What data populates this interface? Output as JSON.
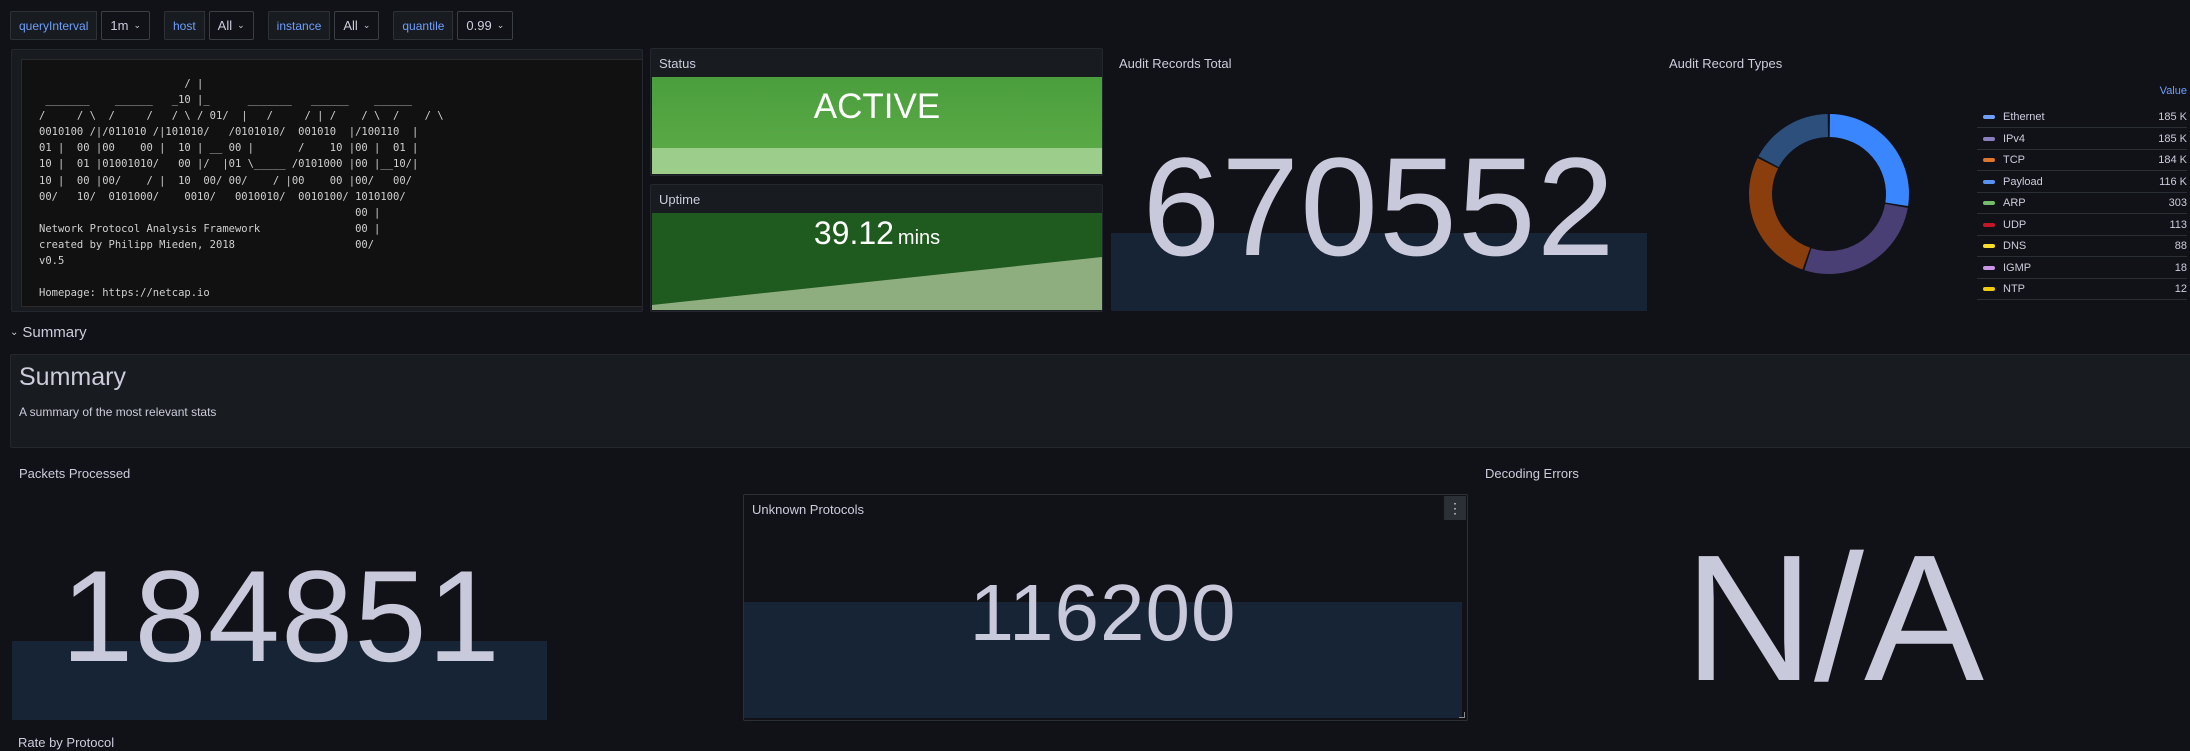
{
  "variables": [
    {
      "label": "queryInterval",
      "value": "1m"
    },
    {
      "label": "host",
      "value": "All"
    },
    {
      "label": "instance",
      "value": "All"
    },
    {
      "label": "quantile",
      "value": "0.99"
    }
  ],
  "ascii": {
    "art": "                       / |\n _______    ______   _10 |_      _______   ______    ______\n/     / \\  /     /   / \\ / 01/  |   /     / | /    / \\  /    / \\\n0010100 /|/011010 /|101010/   /0101010/  001010  |/100110  |\n01 |  00 |00    00 |  10 | __ 00 |       /    10 |00 |  01 |\n10 |  01 |01001010/   00 |/  |01 \\_____ /0101000 |00 |__10/|\n10 |  00 |00/    / |  10  00/ 00/    / |00    00 |00/   00/\n00/   10/  0101000/    0010/   0010010/  0010100/ 1010100/\n                                                  00 |\nNetwork Protocol Analysis Framework               00 |\ncreated by Philipp Mieden, 2018                   00/\nv0.5\n\nHomepage: https://netcap.io"
  },
  "status": {
    "title": "Status",
    "value": "ACTIVE",
    "color": "#56a64b"
  },
  "uptime": {
    "title": "Uptime",
    "value": "39.12",
    "unit": "mins",
    "color": "#1f5a1e"
  },
  "audit_total": {
    "title": "Audit Records Total",
    "value": "670552"
  },
  "audit_types": {
    "title": "Audit Record Types",
    "legend_header": "Value",
    "items": [
      {
        "name": "Ethernet",
        "value": "185 K",
        "color": "#6e9fff"
      },
      {
        "name": "IPv4",
        "value": "185 K",
        "color": "#8a7fbf"
      },
      {
        "name": "TCP",
        "value": "184 K",
        "color": "#e0752d"
      },
      {
        "name": "Payload",
        "value": "116 K",
        "color": "#5794f2"
      },
      {
        "name": "ARP",
        "value": "303",
        "color": "#73bf69"
      },
      {
        "name": "UDP",
        "value": "113",
        "color": "#c4162a"
      },
      {
        "name": "DNS",
        "value": "88",
        "color": "#fade2a"
      },
      {
        "name": "IGMP",
        "value": "18",
        "color": "#ca95e5"
      },
      {
        "name": "NTP",
        "value": "12",
        "color": "#f2cc0c"
      }
    ],
    "slice_values": [
      185,
      185,
      184,
      116,
      0.303,
      0.113,
      0.088,
      0.018,
      0.012
    ],
    "slice_colors": [
      "#3a86ff",
      "#4a3f75",
      "#8a3e0e",
      "#2c4f7c",
      "#73bf69",
      "#c4162a",
      "#fade2a",
      "#ca95e5",
      "#f2cc0c"
    ]
  },
  "row": {
    "title": "Summary"
  },
  "summary": {
    "heading": "Summary",
    "text": "A summary of the most relevant stats"
  },
  "packets": {
    "title": "Packets Processed",
    "value": "184851"
  },
  "unknown": {
    "title": "Unknown Protocols",
    "value": "116200",
    "menu": "⋮"
  },
  "decoding": {
    "title": "Decoding Errors",
    "value": "N/A"
  },
  "rate": {
    "title": "Rate by Protocol"
  }
}
